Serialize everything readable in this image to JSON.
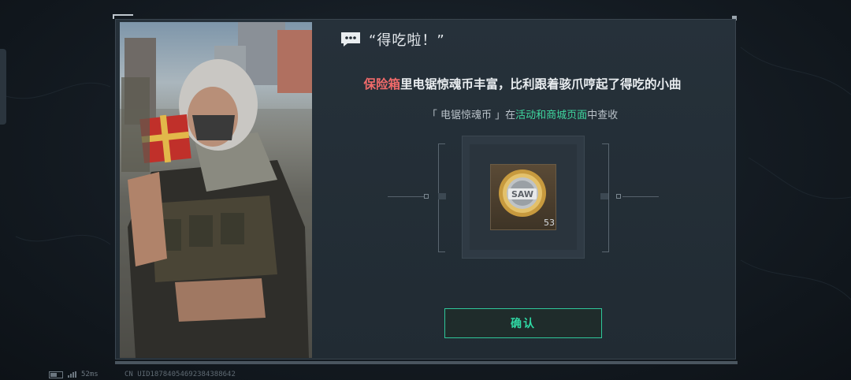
{
  "dialog": {
    "title": "“得吃啦！”",
    "headline": {
      "highlight": "保险箱",
      "rest": "里电锯惊魂币丰富，比利跟着骇爪哼起了得吃的小曲"
    },
    "subline": {
      "prefix": "「 电锯惊魂币 」在",
      "highlight": "活动和商城页面",
      "suffix": "中查收"
    },
    "reward": {
      "icon": "saw-coin-icon",
      "count": "53"
    },
    "confirm_label": "确认"
  },
  "status": {
    "ping": "52ms",
    "uid": "CN UID18784054692384388642"
  },
  "colors": {
    "highlight_red": "#f06a6a",
    "highlight_green": "#3fd9a0",
    "confirm_green": "#2fd9a4"
  }
}
